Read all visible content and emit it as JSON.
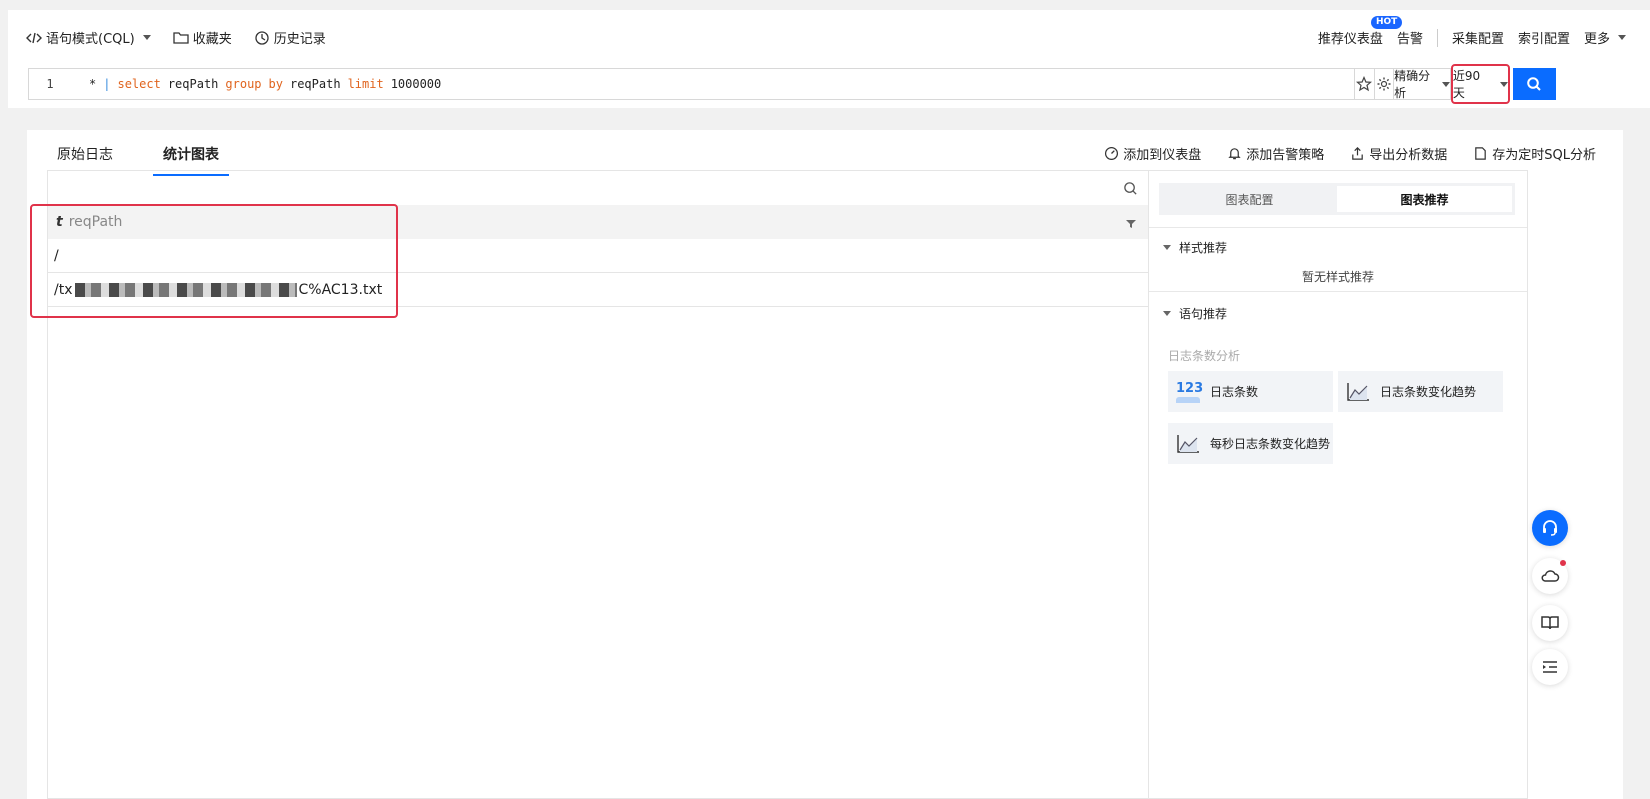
{
  "toolbar": {
    "mode_label": "语句模式(CQL)",
    "favorites_label": "收藏夹",
    "history_label": "历史记录",
    "recommended_dashboard_label": "推荐仪表盘",
    "hot_badge": "HOT",
    "alert_label": "告警",
    "collect_config_label": "采集配置",
    "index_config_label": "索引配置",
    "more_label": "更多"
  },
  "query": {
    "line_number": "1",
    "tokens": [
      "*",
      "|",
      "select",
      "reqPath",
      "group",
      "by",
      "reqPath",
      "limit",
      "1000000"
    ],
    "analysis_mode": "精确分析",
    "time_range": "近90天"
  },
  "tabs": {
    "raw_log": "原始日志",
    "stats_chart": "统计图表"
  },
  "actions": {
    "add_dashboard": "添加到仪表盘",
    "add_alert": "添加告警策略",
    "export": "导出分析数据",
    "save_sql": "存为定时SQL分析"
  },
  "table": {
    "type_flag": "t",
    "column": "reqPath",
    "rows": [
      {
        "prefix": "/",
        "suffix": ""
      },
      {
        "prefix": "/tx",
        "suffix": "C%AC13.txt"
      }
    ]
  },
  "panel": {
    "tab_config": "图表配置",
    "tab_recommend": "图表推荐",
    "style_section": "样式推荐",
    "no_style": "暂无样式推荐",
    "statement_section": "语句推荐",
    "log_count_group": "日志条数分析",
    "cards": [
      "日志条数",
      "日志条数变化趋势",
      "每秒日志条数变化趋势"
    ],
    "card_123_glyph": "123"
  },
  "colors": {
    "primary": "#0a6cff",
    "highlight_border": "#e0334a",
    "keyword": "#e0641e"
  }
}
